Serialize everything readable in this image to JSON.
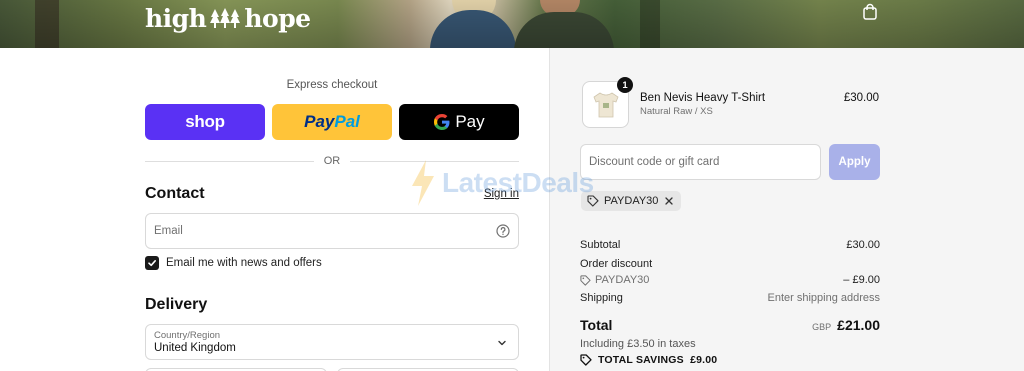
{
  "header": {
    "logo_text_left": "high",
    "logo_text_right": "hope",
    "cart_icon": "shopping-bag-icon"
  },
  "express": {
    "title": "Express checkout",
    "shop_label": "shop",
    "paypal_label_1": "Pay",
    "paypal_label_2": "Pal",
    "gpay_label": "Pay",
    "or_label": "OR"
  },
  "contact": {
    "title": "Contact",
    "signin_label": "Sign in",
    "email_placeholder": "Email",
    "newsletter_label": "Email me with news and offers",
    "newsletter_checked": true
  },
  "delivery": {
    "title": "Delivery",
    "country_label": "Country/Region",
    "country_value": "United Kingdom"
  },
  "order": {
    "quantity": "1",
    "product_name": "Ben Nevis Heavy T-Shirt",
    "product_variant": "Natural Raw / XS",
    "product_price": "£30.00",
    "discount_placeholder": "Discount code or gift card",
    "apply_label": "Apply",
    "applied_code": "PAYDAY30",
    "subtotal_label": "Subtotal",
    "subtotal_value": "£30.00",
    "order_discount_label": "Order discount",
    "discount_code": "PAYDAY30",
    "discount_value": "– £9.00",
    "shipping_label": "Shipping",
    "shipping_value": "Enter shipping address",
    "total_label": "Total",
    "total_currency": "GBP",
    "total_value": "£21.00",
    "taxes_text": "Including £3.50 in taxes",
    "savings_text": "TOTAL SAVINGS  £9.00"
  },
  "watermark": {
    "text": "LatestDeals"
  },
  "colors": {
    "shop": "#5a31f4",
    "paypal": "#ffc439",
    "gpay": "#000000",
    "apply": "#a9b1e9",
    "summary_bg": "#f5f5f5"
  }
}
